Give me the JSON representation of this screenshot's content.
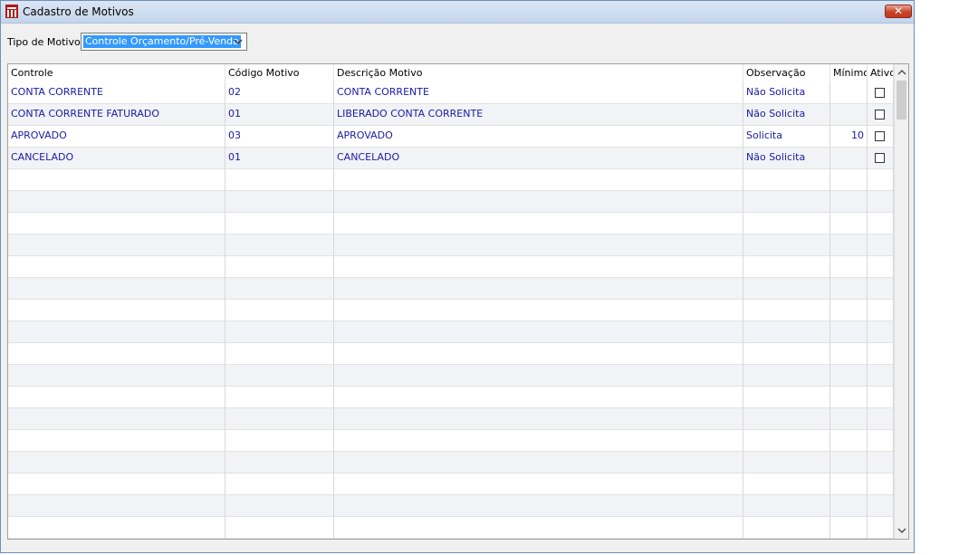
{
  "window": {
    "title": "Cadastro de Motivos",
    "close_glyph": "✕",
    "icon": "app-logo-icon"
  },
  "filter": {
    "label": "Tipo de Motivo",
    "selected": "Controle Orçamento/Pré-Venda"
  },
  "grid": {
    "columns": [
      "Controle",
      "Código Motivo",
      "Descrição Motivo",
      "Observação",
      "Mínimo",
      "Ativo"
    ],
    "rows": [
      {
        "controle": "CONTA CORRENTE",
        "codigo": "02",
        "descricao": "CONTA CORRENTE",
        "observacao": "Não Solicita",
        "minimo": "",
        "ativo": false
      },
      {
        "controle": "CONTA CORRENTE FATURADO",
        "codigo": "01",
        "descricao": "LIBERADO CONTA CORRENTE",
        "observacao": "Não Solicita",
        "minimo": "",
        "ativo": false
      },
      {
        "controle": "APROVADO",
        "codigo": "03",
        "descricao": "APROVADO",
        "observacao": "Solicita",
        "minimo": "10",
        "ativo": false
      },
      {
        "controle": "CANCELADO",
        "codigo": "01",
        "descricao": "CANCELADO",
        "observacao": "Não Solicita",
        "minimo": "",
        "ativo": false
      }
    ]
  },
  "colors": {
    "cell_text": "#1a1aa6",
    "selection": "#3399ff",
    "alt_row": "#f2f3f6"
  }
}
